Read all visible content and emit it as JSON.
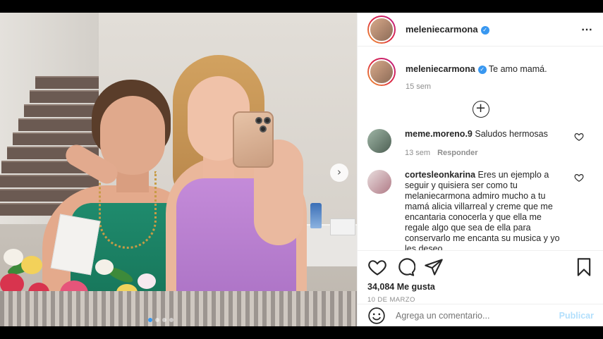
{
  "post": {
    "username": "meleniecarmona",
    "verified_badge": "✓",
    "more_icon": "⋯",
    "next_icon": "›",
    "carousel": {
      "count": 4,
      "active_index": 0
    }
  },
  "caption": {
    "username": "meleniecarmona",
    "text": "Te amo mamá.",
    "time": "15 sem"
  },
  "load_more_icon": "+",
  "comments": [
    {
      "username": "meme.moreno.9",
      "text": "Saludos hermosas",
      "time": "13 sem",
      "reply_label": "Responder"
    },
    {
      "username": "cortesleonkarina",
      "text": "Eres un ejemplo a seguir y quisiera ser como tu melaniecarmona admiro mucho a tu mamá alicia villarreal y creme que me encantaria conocerla y que ella me regale algo que sea de ella para conservarlo me encanta su musica y yo les deseo"
    }
  ],
  "actions": {
    "likes": "34,084 Me gusta",
    "date": "10 DE MARZO"
  },
  "comment_box": {
    "placeholder": "Agrega un comentario...",
    "publish_label": "Publicar"
  },
  "colors": {
    "accent": "#3897f0",
    "publish_disabled": "#b2dffc",
    "meta": "#8e8e8e"
  }
}
